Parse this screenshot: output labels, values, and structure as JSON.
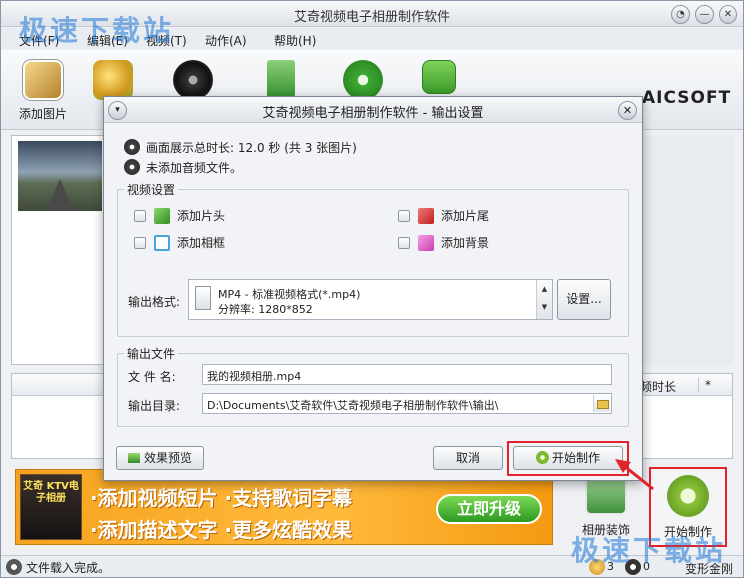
{
  "app": {
    "title": "艾奇视频电子相册制作软件",
    "watermark": "极速下载站"
  },
  "window_controls": {
    "menu": "◔",
    "minimize": "—",
    "maximize": "□",
    "close": "✕"
  },
  "menubar": {
    "items": [
      "文件(F)",
      "编辑(E)",
      "视频(T)",
      "动作(A)",
      "帮助(H)"
    ]
  },
  "toolbar": {
    "items": [
      {
        "label": "添加图片",
        "icon": "add-image-icon",
        "color": "#c8a24a"
      },
      {
        "label": "",
        "icon": "effects-icon",
        "color": "#d6a83c"
      },
      {
        "label": "",
        "icon": "add-music-icon",
        "color": "#3a3a3a"
      },
      {
        "label": "",
        "icon": "delete-icon",
        "color": "#4aa24a"
      },
      {
        "label": "",
        "icon": "settings-gear-icon",
        "color": "#3ea833"
      },
      {
        "label": "",
        "icon": "share-icon",
        "color": "#5bb43a"
      }
    ],
    "brand": "AICSOFT"
  },
  "grid": {
    "columns": [
      "频时长",
      "*"
    ]
  },
  "ad": {
    "box": "艾奇 KTV电子相册",
    "line1": "·添加视频短片 ·支持歌词字幕",
    "line2": "·添加描述文字 ·更多炫酷效果",
    "upgrade": "立即升级"
  },
  "bottom_buttons": {
    "decorate": "相册装饰",
    "start": "开始制作"
  },
  "statusbar": {
    "text": "文件载入完成。",
    "count_images": "3",
    "count_audio": "0",
    "right_text": "变形金刚"
  },
  "dialog": {
    "title": "艾奇视频电子相册制作软件 - 输出设置",
    "info_duration": "画面展示总时长: 12.0 秒 (共 3 张图片)",
    "info_audio": "未添加音频文件。",
    "video_settings_legend": "视频设置",
    "options": {
      "add_intro": "添加片头",
      "add_outro": "添加片尾",
      "add_frame": "添加相框",
      "add_background": "添加背景"
    },
    "format_label": "输出格式:",
    "format_name": "MP4 - 标准视频格式(*.mp4)",
    "format_resolution": "分辨率: 1280*852",
    "settings_button": "设置...",
    "output_legend": "输出文件",
    "filename_label": "文 件 名:",
    "filename_value": "我的视频相册.mp4",
    "dir_label": "输出目录:",
    "dir_value": "D:\\Documents\\艾奇软件\\艾奇视频电子相册制作软件\\输出\\",
    "preview_button": "效果预览",
    "cancel_button": "取消",
    "start_button": "开始制作"
  },
  "colors": {
    "highlight_red": "#e1242a",
    "ad_orange": "#f5a31f",
    "watermark_blue": "#1e78d7"
  }
}
